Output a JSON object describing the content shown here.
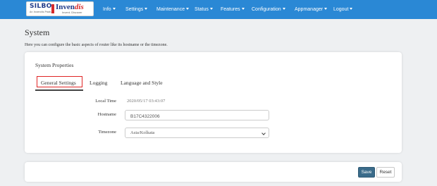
{
  "brand": {
    "silbo": "SILBO",
    "silbo_tagline": "An Invendis Product",
    "invendis": "Invendis",
    "invendis_tagline": "Invent. Discover"
  },
  "nav": {
    "items": [
      {
        "label": "Info"
      },
      {
        "label": "Settings"
      },
      {
        "label": "Maintenance"
      },
      {
        "label": "Status"
      },
      {
        "label": "Features"
      },
      {
        "label": "Configuration"
      },
      {
        "label": "Appmanager"
      },
      {
        "label": "Logout"
      }
    ]
  },
  "page": {
    "title": "System",
    "description": "Here you can configure the basic aspects of router like its hostname or the timezone."
  },
  "card": {
    "header": "System Properties",
    "tabs": [
      {
        "label": "General Settings",
        "active": true
      },
      {
        "label": "Logging"
      },
      {
        "label": "Language and Style"
      }
    ]
  },
  "form": {
    "local_time_label": "Local Time",
    "local_time_value": "2020/05/17 03:43:07",
    "hostname_label": "Hostname",
    "hostname_value": "B17C4322006",
    "timezone_label": "Timezone",
    "timezone_value": "Asia/Kolkata"
  },
  "footer": {
    "save_label": "Save",
    "reset_label": "Reset"
  },
  "colors": {
    "navbar": "#2a88d5",
    "active_tab_outline": "#e02525",
    "save_button": "#3a6b8a"
  }
}
